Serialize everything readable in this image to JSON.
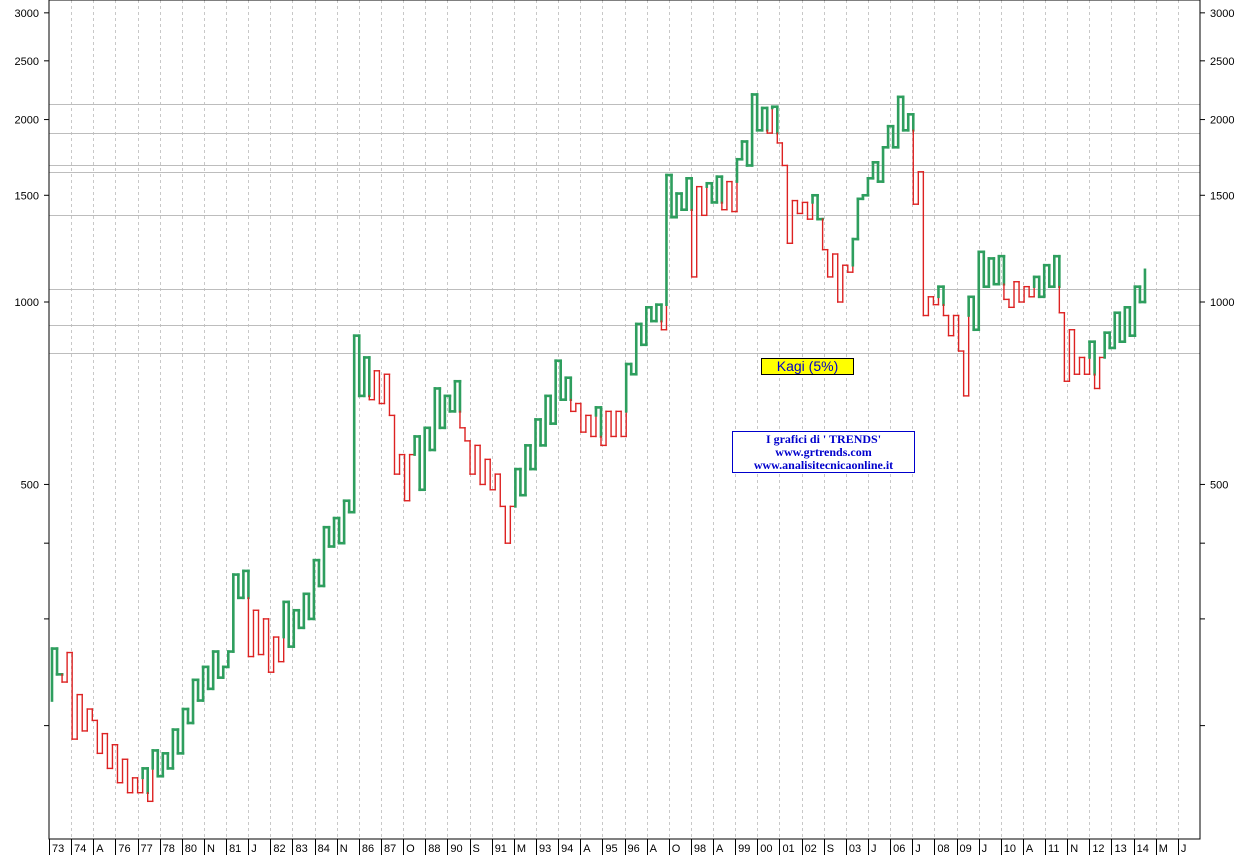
{
  "chart_data": {
    "type": "kagi",
    "title": "",
    "reversal_label": "Kagi (5%)",
    "info_lines": [
      "I grafici di ' TRENDS'",
      "www.grtrends.com",
      "www.analisitecnicaonline.it"
    ],
    "y_scale": "log",
    "ylim": [
      130,
      3150
    ],
    "y_tick_labels": [
      {
        "value": 3000,
        "label": "3000"
      },
      {
        "value": 2500,
        "label": "2500"
      },
      {
        "value": 2000,
        "label": "2000"
      },
      {
        "value": 1500,
        "label": "1500"
      },
      {
        "value": 1000,
        "label": "1000"
      },
      {
        "value": 500,
        "label": "500"
      }
    ],
    "y_minor_ticks": [
      400,
      300,
      200
    ],
    "horizontal_levels": [
      2120,
      1900,
      1680,
      1640,
      1390,
      1050,
      915,
      825
    ],
    "x_labels": [
      "73",
      "74",
      "A",
      "76",
      "77",
      "78",
      "80",
      "N",
      "81",
      "J",
      "82",
      "83",
      "84",
      "N",
      "86",
      "87",
      "O",
      "88",
      "90",
      "S",
      "91",
      "M",
      "93",
      "94",
      "A",
      "95",
      "96",
      "A",
      "O",
      "98",
      "A",
      "99",
      "00",
      "01",
      "02",
      "S",
      "03",
      "J",
      "06",
      "J",
      "08",
      "09",
      "J",
      "10",
      "A",
      "11",
      "N",
      "12",
      "13",
      "14",
      "M",
      "J"
    ],
    "colors": {
      "up": "#2e9e5e",
      "down": "#dd2222",
      "grid": "#c8c8c8",
      "level": "#bdbdbd",
      "text_blue": "#0000cc",
      "badge": "#ffff00"
    },
    "kagi_values": [
      220,
      268,
      243,
      236,
      264,
      190,
      225,
      196,
      213,
      204,
      180,
      194,
      170,
      186,
      161,
      176,
      155,
      164,
      155,
      170,
      150,
      182,
      165,
      180,
      170,
      197,
      180,
      213,
      202,
      238,
      220,
      250,
      230,
      265,
      240,
      250,
      265,
      355,
      325,
      360,
      260,
      310,
      262,
      300,
      245,
      280,
      255,
      320,
      270,
      310,
      290,
      330,
      300,
      375,
      340,
      425,
      395,
      440,
      400,
      470,
      450,
      880,
      700,
      810,
      690,
      770,
      680,
      760,
      650,
      520,
      560,
      470,
      560,
      600,
      490,
      620,
      570,
      720,
      620,
      700,
      660,
      740,
      620,
      590,
      520,
      580,
      500,
      550,
      490,
      520,
      460,
      400,
      460,
      530,
      480,
      580,
      530,
      640,
      580,
      700,
      630,
      800,
      690,
      750,
      660,
      680,
      610,
      650,
      600,
      670,
      580,
      660,
      600,
      660,
      600,
      790,
      760,
      920,
      850,
      980,
      930,
      990,
      900,
      1620,
      1380,
      1510,
      1420,
      1600,
      1100,
      1550,
      1390,
      1570,
      1460,
      1610,
      1420,
      1580,
      1410,
      1720,
      1840,
      1680,
      2200,
      1920,
      2090,
      1900,
      2100,
      1830,
      1680,
      1250,
      1470,
      1400,
      1460,
      1370,
      1500,
      1370,
      1220,
      1100,
      1200,
      1000,
      1150,
      1120,
      1270,
      1480,
      1500,
      1600,
      1700,
      1580,
      1800,
      1950,
      1800,
      2180,
      1920,
      2040,
      1450,
      1640,
      950,
      1020,
      990,
      1060,
      950,
      880,
      950,
      830,
      700,
      1020,
      900,
      1210,
      1060,
      1180,
      1070,
      1190,
      1010,
      980,
      1080,
      1000,
      1060,
      1020,
      1100,
      1020,
      1150,
      1060,
      1190,
      960,
      740,
      900,
      760,
      810,
      760,
      860,
      720,
      810,
      890,
      840,
      960,
      860,
      980,
      880,
      1060,
      1000,
      1130
    ]
  }
}
